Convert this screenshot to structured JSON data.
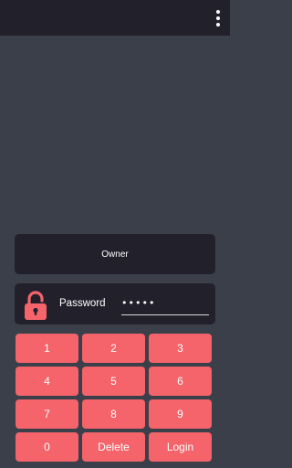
{
  "appbar": {
    "menu_icon": "more-vert-icon"
  },
  "owner": {
    "label": "Owner"
  },
  "password": {
    "lock_icon": "lock-icon",
    "label": "Password",
    "value": "•••••"
  },
  "keypad": {
    "keys": [
      "1",
      "2",
      "3",
      "4",
      "5",
      "6",
      "7",
      "8",
      "9",
      "0",
      "Delete",
      "Login"
    ]
  },
  "colors": {
    "background": "#3b3f49",
    "card": "#22212b",
    "accent": "#f4646a"
  }
}
